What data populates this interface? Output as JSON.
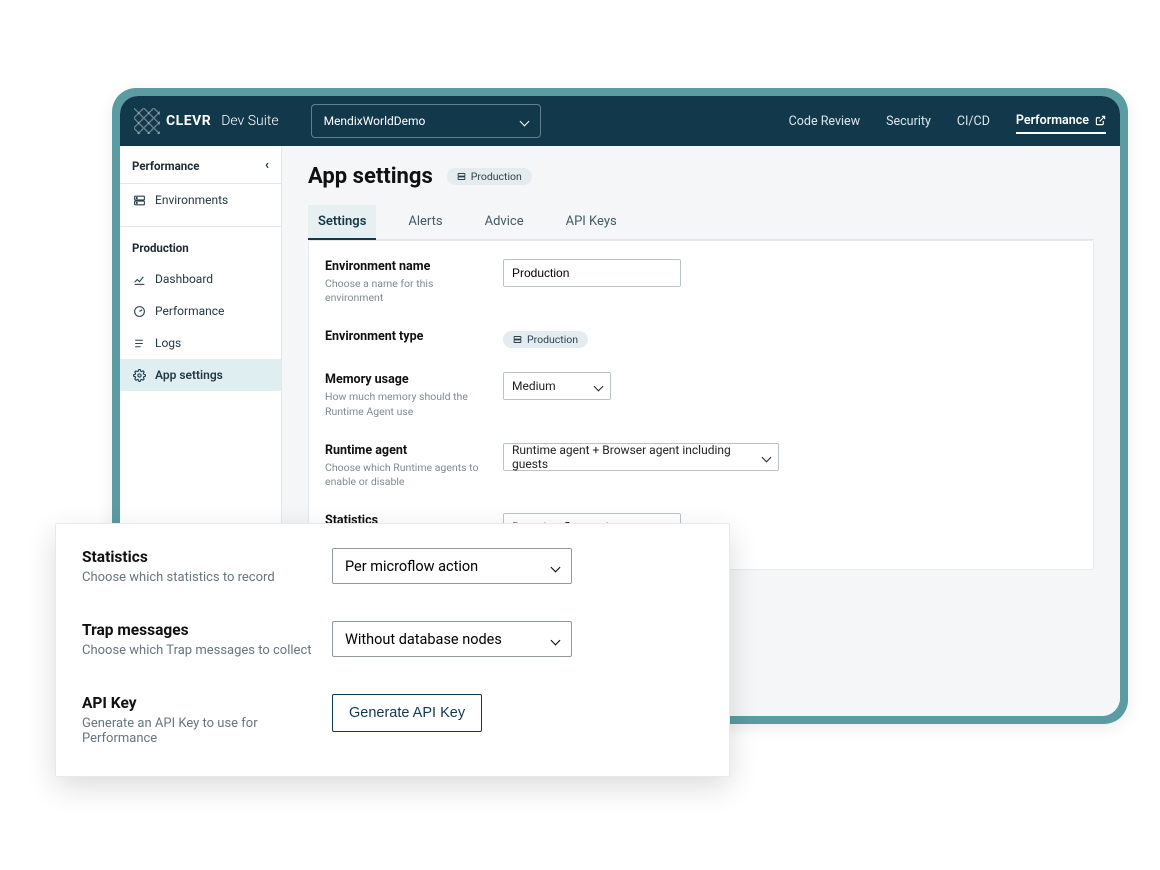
{
  "brand": {
    "strong": "CLEVR",
    "light": "Dev Suite"
  },
  "project_selector": {
    "value": "MendixWorldDemo"
  },
  "topnav": {
    "items": [
      "Code Review",
      "Security",
      "CI/CD",
      "Performance"
    ],
    "active": "Performance"
  },
  "sidebar": {
    "title": "Performance",
    "items_top": [
      {
        "label": "Environments",
        "icon": "server-icon"
      }
    ],
    "section": "Production",
    "items": [
      {
        "label": "Dashboard",
        "icon": "chart-icon"
      },
      {
        "label": "Performance",
        "icon": "gauge-icon"
      },
      {
        "label": "Logs",
        "icon": "list-icon"
      },
      {
        "label": "App settings",
        "icon": "gear-icon",
        "active": true
      }
    ]
  },
  "page": {
    "title": "App settings",
    "badge": "Production",
    "tabs": [
      "Settings",
      "Alerts",
      "Advice",
      "API Keys"
    ],
    "active_tab": "Settings"
  },
  "form": {
    "env_name": {
      "label": "Environment name",
      "help": "Choose a name for this environment",
      "value": "Production"
    },
    "env_type": {
      "label": "Environment type",
      "badge": "Production"
    },
    "memory": {
      "label": "Memory usage",
      "help": "How much memory should the Runtime Agent use",
      "value": "Medium"
    },
    "runtime": {
      "label": "Runtime agent",
      "help": "Choose which Runtime agents to enable or disable",
      "value": "Runtime agent + Browser agent including guests"
    },
    "stats": {
      "label": "Statistics",
      "help": "Choose which statistics to record",
      "value": "Per microflow action"
    }
  },
  "zoom": {
    "stats": {
      "label": "Statistics",
      "help": "Choose which statistics to record",
      "value": "Per microflow action"
    },
    "trap": {
      "label": "Trap messages",
      "help": "Choose which Trap messages to collect",
      "value": "Without database nodes"
    },
    "apikey": {
      "label": "API Key",
      "help": "Generate an API Key to use for Performance",
      "button": "Generate API Key"
    }
  }
}
